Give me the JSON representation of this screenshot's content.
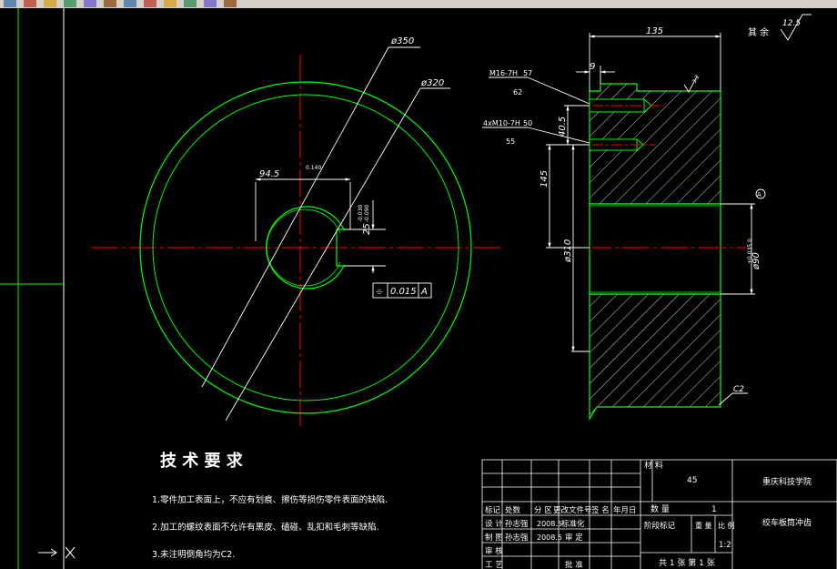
{
  "toolbar": {
    "icons": [
      "zoom-icon",
      "pan-icon",
      "undo-icon",
      "redo-icon",
      "open-icon",
      "save-icon",
      "print-icon",
      "cut-icon",
      "copy-icon",
      "paste-icon",
      "match-icon",
      "help-icon"
    ]
  },
  "colors": {
    "background": "#000000",
    "outline": "#00ff00",
    "centerline": "#ff0000",
    "dimension": "#ffffff",
    "text": "#ffffff",
    "hatch": "#ffffff"
  },
  "front_view": {
    "dia_outer": "ø350",
    "dia_inner": "ø320",
    "keyway_width": "94.5",
    "keyway_width_tol": "0.140",
    "keyway_height": "25",
    "keyway_height_tol_upper": "-0.030",
    "keyway_height_tol_lower": "-0.090",
    "flatness_symbol": "⌯",
    "flatness_value": "0.015",
    "flatness_datum": "A"
  },
  "side_view": {
    "width": "135",
    "offset": "9",
    "dim_40_5": "40.5",
    "dim_145": "145",
    "dia_310": "ø310",
    "bore": "ø90",
    "bore_tol": "+0.035 0",
    "thread1": "M16-7H",
    "thread1_depth": "57",
    "thread1_drill": "62",
    "thread2": "4xM10-7H",
    "thread2_depth": "50",
    "thread2_drill": "55",
    "roughness_local": "3.2",
    "chamfer": "C2",
    "datum": "A"
  },
  "surface_note": {
    "label": "其 余",
    "value": "12.5"
  },
  "tech": {
    "title": "技 术 要 求",
    "items": [
      "1.零件加工表面上，不应有划痕、擦伤等损伤零件表面的缺陷.",
      "2.加工的螺纹表面不允许有黑皮、磕碰、乱扣和毛刺等缺陷.",
      "3.未注明倒角均为C2."
    ]
  },
  "title_block": {
    "material_label": "材 料",
    "material": "45",
    "school": "重庆科技学院",
    "part_name": "绞车板筒冲齿",
    "rows": [
      [
        "标记",
        "处数",
        "分 区",
        "更改文件号",
        "签 名",
        "年月日"
      ],
      [
        "设 计",
        "孙志强",
        "2008.5",
        "标准化"
      ],
      [
        "制 图",
        "孙志强",
        "2008.5",
        "审 定"
      ],
      [
        "审 核"
      ],
      [
        "工 艺",
        "",
        "",
        "批 准"
      ]
    ],
    "qty_label": "数 量",
    "qty": "1",
    "stage_label": "阶段标记",
    "weight_label": "重 量",
    "scale_label": "比 例",
    "scale": "1:2",
    "sheet": "共 1 张  第 1 张"
  }
}
